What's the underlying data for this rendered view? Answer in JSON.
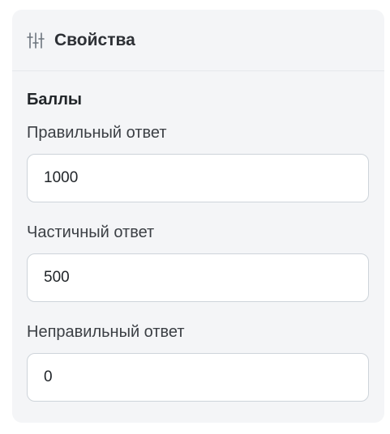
{
  "panel": {
    "title": "Свойства",
    "icon": "sliders-icon"
  },
  "section": {
    "title": "Баллы"
  },
  "fields": [
    {
      "label": "Правильный ответ",
      "value": "1000"
    },
    {
      "label": "Частичный ответ",
      "value": "500"
    },
    {
      "label": "Неправильный ответ",
      "value": "0"
    }
  ],
  "colors": {
    "panel_bg": "#f4f5f7",
    "input_border": "#ced4da",
    "text": "#212529"
  }
}
